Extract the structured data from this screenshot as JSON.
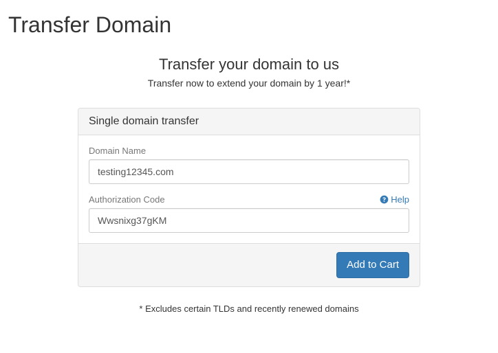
{
  "page": {
    "title": "Transfer Domain"
  },
  "hero": {
    "headline": "Transfer your domain to us",
    "subheadline": "Transfer now to extend your domain by 1 year!*"
  },
  "panel": {
    "heading": "Single domain transfer",
    "domain": {
      "label": "Domain Name",
      "value": "testing12345.com"
    },
    "authcode": {
      "label": "Authorization Code",
      "value": "Wwsnixg37gKM",
      "help_label": "Help"
    },
    "submit_label": "Add to Cart"
  },
  "disclaimer": "* Excludes certain TLDs and recently renewed domains"
}
